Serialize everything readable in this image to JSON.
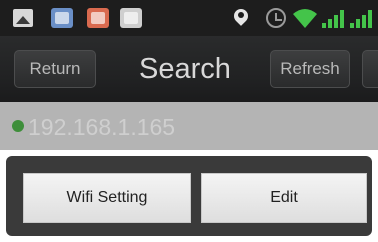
{
  "status_bar": {
    "icons": [
      "image-icon",
      "app-icon",
      "app-icon",
      "app-icon",
      "location-pin-icon",
      "alarm-icon",
      "wifi-icon",
      "signal-icon",
      "signal-icon"
    ]
  },
  "header": {
    "back_label": "Return",
    "title": "Search",
    "refresh_label": "Refresh"
  },
  "connection": {
    "ip": "192.168.1.165",
    "status_color": "#3e8e3a"
  },
  "actions": {
    "wifi_setting_label": "Wifi Setting",
    "edit_label": "Edit"
  }
}
